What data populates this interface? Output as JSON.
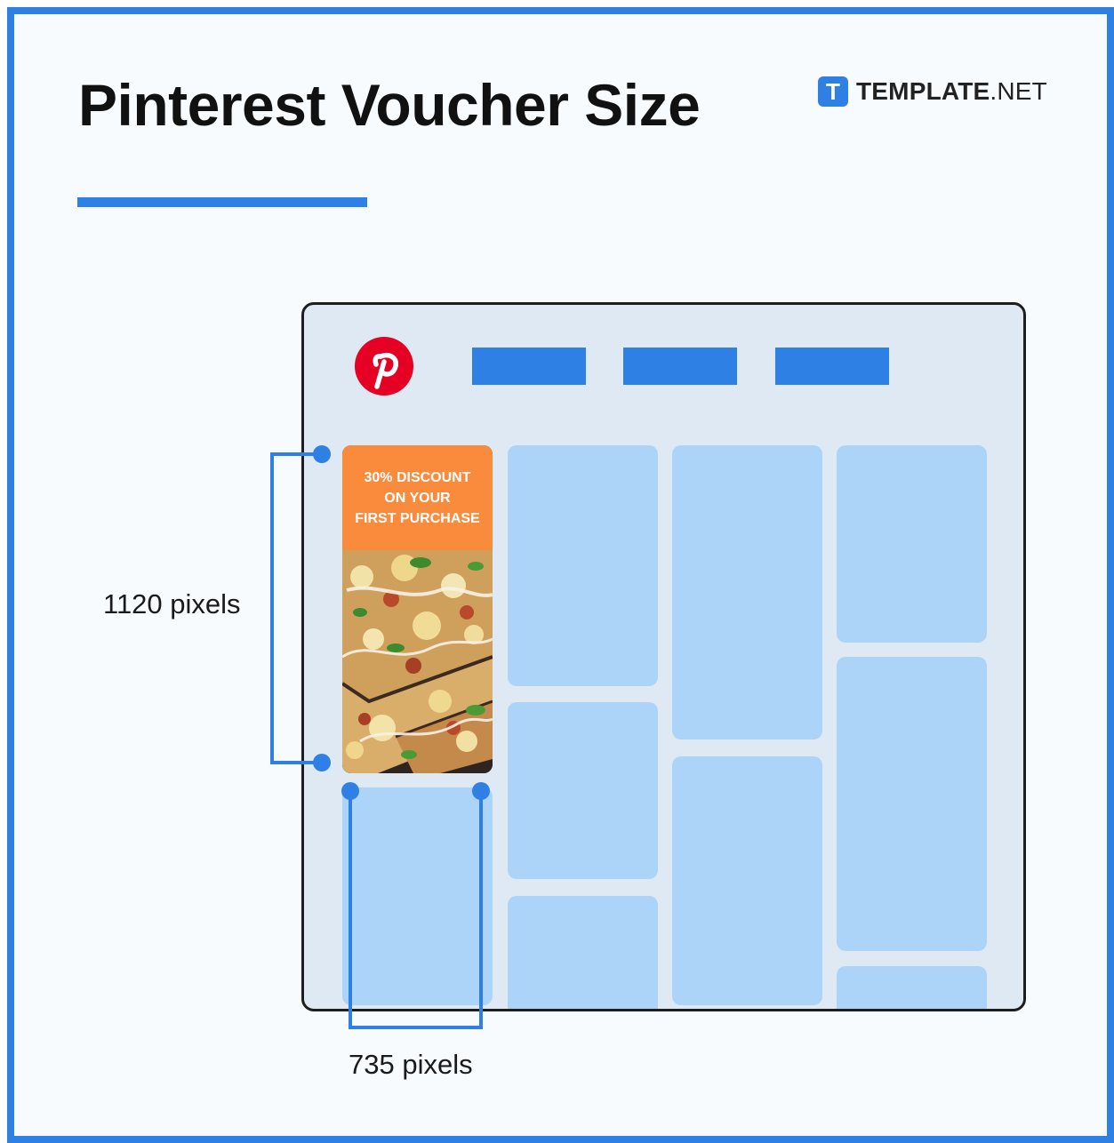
{
  "title": "Pinterest Voucher Size",
  "brand": {
    "mark": "T",
    "name_bold": "TEMPLATE",
    "name_rest": ".NET"
  },
  "voucher": {
    "text": "30% DISCOUNT\nON YOUR\nFIRST PURCHASE"
  },
  "dimensions": {
    "height_label": "1120 pixels",
    "width_label": "735 pixels"
  },
  "colors": {
    "accent": "#2f80e4",
    "pinterest_red": "#e60023",
    "tile": "#acd4f9",
    "banner": "#fb8b3c"
  },
  "icons": {
    "brand": "template-logo-icon",
    "social": "pinterest-logo-icon"
  }
}
